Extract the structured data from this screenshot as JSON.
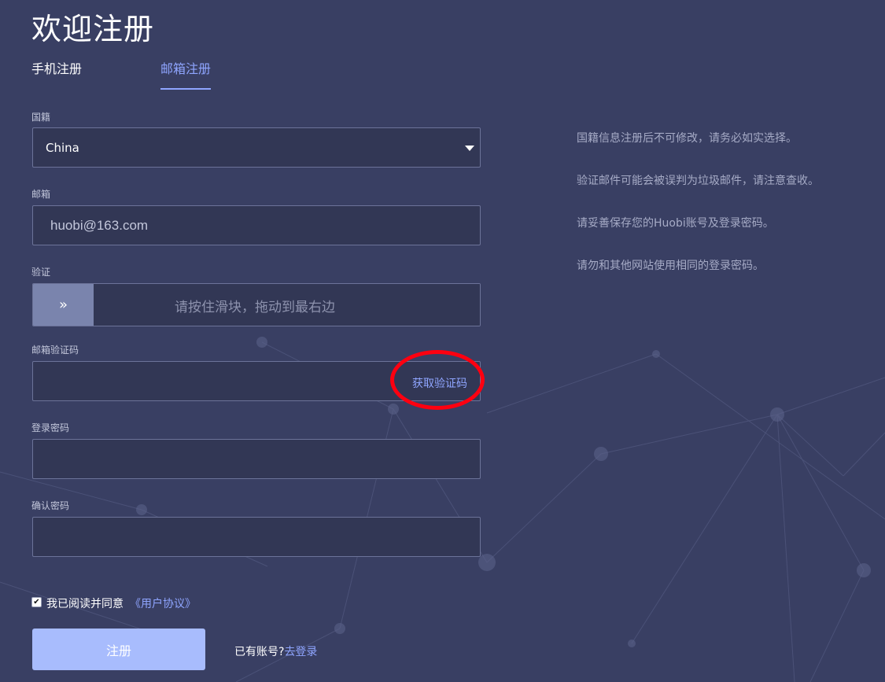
{
  "page": {
    "title": "欢迎注册"
  },
  "tabs": [
    {
      "label": "手机注册",
      "active": false
    },
    {
      "label": "邮箱注册",
      "active": true
    }
  ],
  "form": {
    "nationality": {
      "label": "国籍",
      "value": "China"
    },
    "email": {
      "label": "邮箱",
      "value": "huobi@163.com"
    },
    "verify": {
      "label": "验证",
      "handle": "»",
      "hint": "请按住滑块，拖动到最右边"
    },
    "email_code": {
      "label": "邮箱验证码",
      "value": "",
      "get_code": "获取验证码"
    },
    "password": {
      "label": "登录密码",
      "value": ""
    },
    "confirm_password": {
      "label": "确认密码",
      "value": ""
    }
  },
  "agreement": {
    "checked": true,
    "text": "我已阅读并同意",
    "link": "《用户协议》"
  },
  "submit_label": "注册",
  "login": {
    "prompt": "已有账号?",
    "link": "去登录"
  },
  "notes": [
    "国籍信息注册后不可修改，请务必如实选择。",
    "验证邮件可能会被误判为垃圾邮件，请注意查收。",
    "请妥善保存您的Huobi账号及登录密码。",
    "请勿和其他网站使用相同的登录密码。"
  ],
  "colors": {
    "background": "#393f63",
    "input_bg": "#323755",
    "accent": "#8fa5ff",
    "button": "#a8bcfd",
    "annotation": "#ff0010"
  }
}
